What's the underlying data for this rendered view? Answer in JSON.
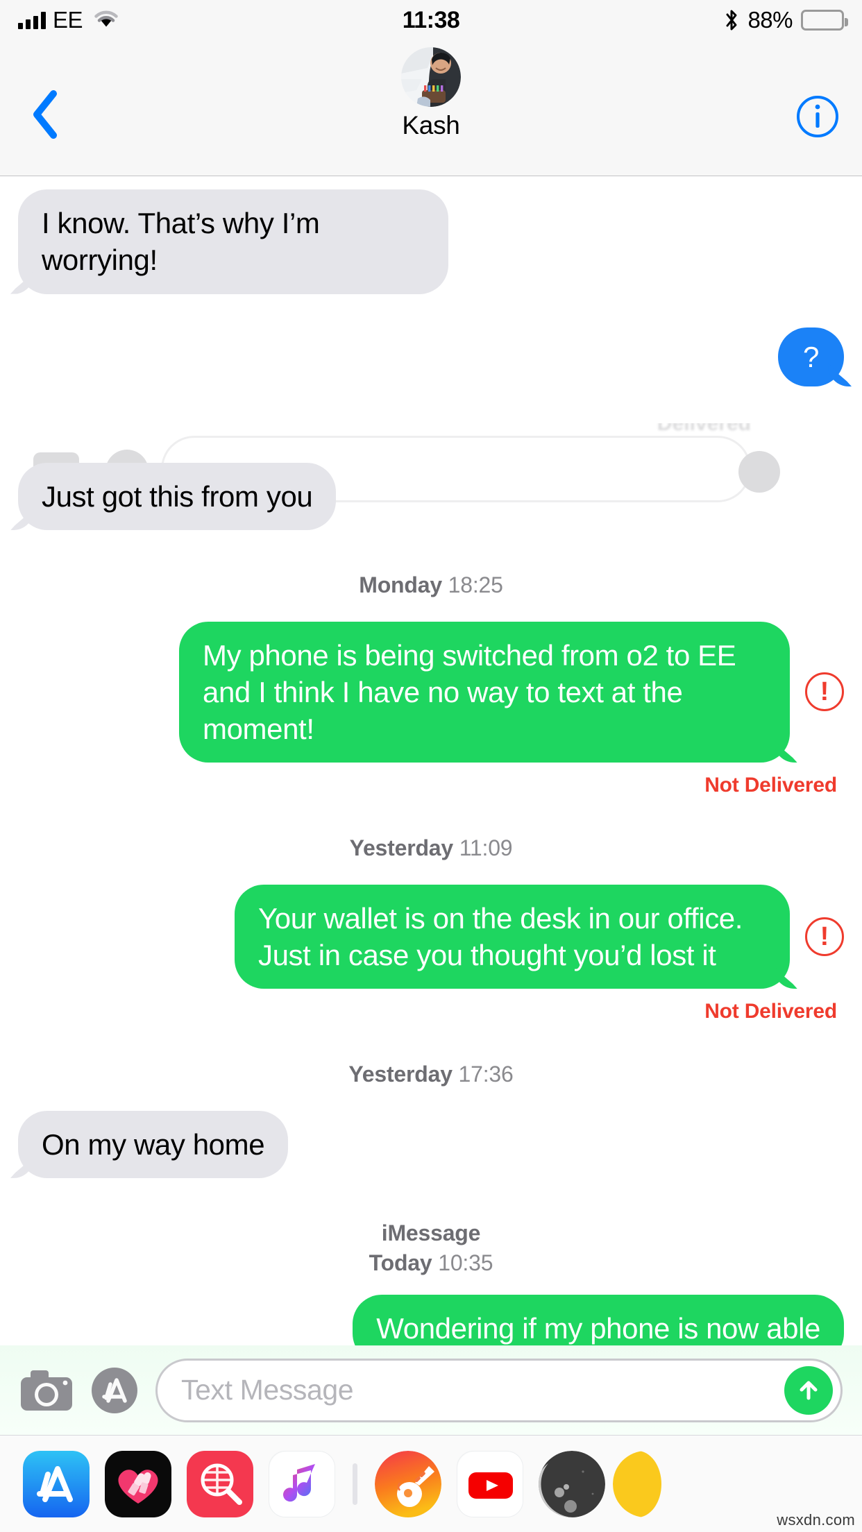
{
  "status_bar": {
    "carrier": "EE",
    "time": "11:38",
    "battery_percent": "88%",
    "signal_icon": "cellular-bars-icon",
    "wifi_icon": "wifi-icon",
    "bluetooth_icon": "bluetooth-icon",
    "battery_icon": "battery-icon"
  },
  "nav_bar": {
    "back_icon": "chevron-left-icon",
    "contact_name": "Kash",
    "avatar_icon": "contact-avatar",
    "info_icon": "info-circle-icon"
  },
  "conversation": {
    "items": [
      {
        "kind": "bubble",
        "side": "left",
        "style": "gray",
        "text": "I know. That’s why I’m worrying!"
      },
      {
        "kind": "bubble",
        "side": "right",
        "style": "blue",
        "text": "?"
      },
      {
        "kind": "status",
        "text": "Delivered",
        "tone": "muted"
      },
      {
        "kind": "bubble",
        "side": "left",
        "style": "gray",
        "text": "Just got this from you"
      },
      {
        "kind": "divider",
        "day": "Monday",
        "time": "18:25"
      },
      {
        "kind": "bubble",
        "side": "right",
        "style": "green",
        "text": "My phone is being switched from o2 to EE and I think I have no way to text at the moment!",
        "error": true
      },
      {
        "kind": "status",
        "text": "Not Delivered",
        "tone": "error"
      },
      {
        "kind": "divider",
        "day": "Yesterday",
        "time": "11:09"
      },
      {
        "kind": "bubble",
        "side": "right",
        "style": "green",
        "text": "Your wallet is on the desk in our office. Just in case you thought you’d lost it",
        "error": true
      },
      {
        "kind": "status",
        "text": "Not Delivered",
        "tone": "error"
      },
      {
        "kind": "divider",
        "day": "Yesterday",
        "time": "17:36"
      },
      {
        "kind": "bubble",
        "side": "left",
        "style": "gray",
        "text": "On my way home"
      },
      {
        "kind": "divider",
        "service": "iMessage",
        "day": "Today",
        "time": "10:35"
      },
      {
        "kind": "bubble",
        "side": "right",
        "style": "green",
        "text": "Wondering if my phone is now able"
      }
    ],
    "error_badge_glyph": "!"
  },
  "input_bar": {
    "camera_icon": "camera-icon",
    "appstore_icon": "app-store-icon",
    "placeholder": "Text Message",
    "value": "",
    "send_icon": "send-arrow-up-icon"
  },
  "dock": {
    "apps": [
      {
        "name": "app-store-app",
        "icon": "app-store-icon"
      },
      {
        "name": "beauty-app",
        "icon": "heart-lipstick-icon"
      },
      {
        "name": "image-search-app",
        "icon": "magnifier-grid-icon"
      },
      {
        "name": "apple-music-app",
        "icon": "music-note-icon"
      },
      {
        "name": "garageband-app",
        "icon": "guitar-icon"
      },
      {
        "name": "youtube-app",
        "icon": "youtube-play-icon"
      },
      {
        "name": "dark-sphere-app",
        "icon": "moon-icon"
      },
      {
        "name": "yellow-app",
        "icon": "yellow-circle-icon"
      }
    ]
  },
  "watermark": {
    "text": "wsxdn.com"
  },
  "colors": {
    "imessage_blue": "#1b82f7",
    "sms_green": "#1ed660",
    "received_gray": "#e5e5ea",
    "error_red": "#ef3b2d",
    "accent_blue": "#007aff",
    "chrome_gray": "#f7f7f7"
  }
}
